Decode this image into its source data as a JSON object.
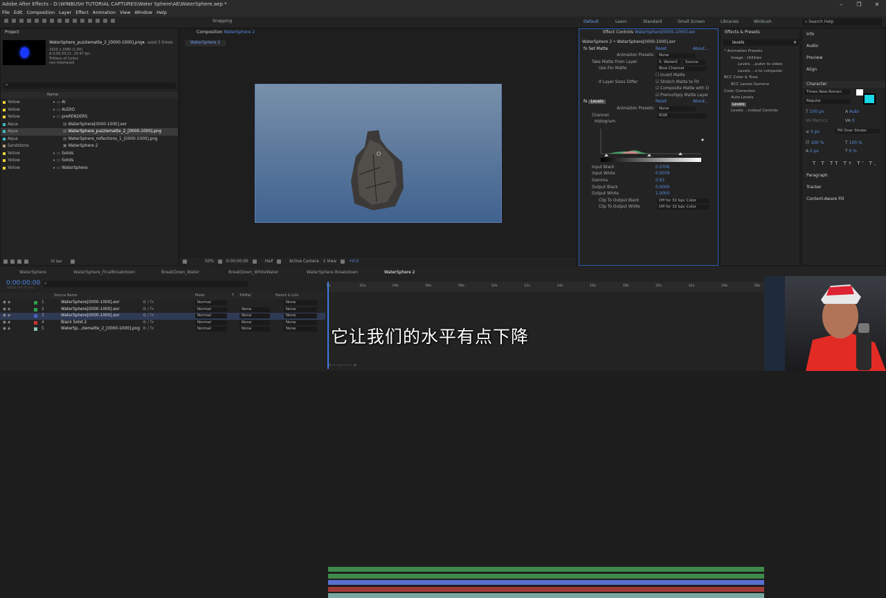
{
  "window": {
    "title": "Adobe After Effects - D:\\WINBUSH TUTORIAL CAPTURES\\Water Sphere\\AE\\WaterSphere.aep *"
  },
  "menu": [
    "File",
    "Edit",
    "Composition",
    "Layer",
    "Effect",
    "Animation",
    "View",
    "Window",
    "Help"
  ],
  "toolbar": {
    "snapping": "Snapping",
    "workspaces": [
      "Default",
      "Learn",
      "Standard",
      "Small Screen",
      "Libraries",
      "Winbush"
    ],
    "search_help": "Search Help"
  },
  "project": {
    "title": "Project",
    "item_name": "WaterSphere_puzzlematte_2_[0000-1000].png▾",
    "used": ", used 5 times",
    "info": [
      "1920 x 1080 (1.00)",
      "Δ 0;00;33;11, 29.97 fps",
      "Trillions of Colors",
      "non-interlaced"
    ],
    "col_name": "Name",
    "items": [
      {
        "label": "Yellow",
        "color": "#e8d23a",
        "name": "AI",
        "type": "folder",
        "indent": 0
      },
      {
        "label": "Yellow",
        "color": "#e8d23a",
        "name": "AUDIO",
        "type": "folder",
        "indent": 0
      },
      {
        "label": "Yellow",
        "color": "#e8d23a",
        "name": "preRENDERS",
        "type": "folder",
        "indent": 0
      },
      {
        "label": "Aqua",
        "color": "#3bbfc4",
        "name": "WaterSphere[0000-1000].exr",
        "type": "file",
        "indent": 1
      },
      {
        "label": "Aqua",
        "color": "#3bbfc4",
        "name": "WaterSphere_puzzlematte_2_[0000-1000].png",
        "type": "file",
        "indent": 1,
        "selected": true
      },
      {
        "label": "Aqua",
        "color": "#3bbfc4",
        "name": "WaterSphere_reflections_1_[0000-1000].png",
        "type": "file",
        "indent": 1
      },
      {
        "label": "Sandstone",
        "color": "#b5a37d",
        "name": "WaterSphere 2",
        "type": "comp",
        "indent": 1
      },
      {
        "label": "Yellow",
        "color": "#e8d23a",
        "name": "Solids",
        "type": "folder",
        "indent": 0
      },
      {
        "label": "Yellow",
        "color": "#e8d23a",
        "name": "Solids",
        "type": "folder",
        "indent": 0
      },
      {
        "label": "Yellow",
        "color": "#e8d23a",
        "name": "WaterSphere",
        "type": "folder",
        "indent": 0
      }
    ],
    "bpc": "32 bpc"
  },
  "composition": {
    "tab": "Composition",
    "comp_name": "WaterSphere 2",
    "subtab": "WaterSphere 2",
    "zoom": "50%",
    "timecode": "0:00:00:00",
    "resolution": "Half",
    "camera": "Active Camera",
    "view": "1 View",
    "exposure": "+0.0"
  },
  "effect_controls": {
    "tab": "Effect Controls",
    "layer": "WaterSphere[0000-1000].exr",
    "path": "WaterSphere 2 • WaterSphere[0000-1000].exr",
    "set_matte": {
      "name": "Set Matte",
      "reset": "Reset",
      "about": "About...",
      "presets_label": "Animation Presets:",
      "presets_value": "None",
      "take_matte_label": "Take Matte From Layer",
      "take_matte_value": "5. WaterS",
      "source": "Source",
      "use_for_matte_label": "Use For Matte",
      "use_for_matte_value": "Blue Channel",
      "invert": "Invert Matte",
      "sizes_differ": "If Layer Sizes Differ",
      "stretch": "Stretch Matte to Fit",
      "composite": "Composite Matte with O",
      "premultiply": "Premultiply Matte Layer"
    },
    "levels": {
      "name": "Levels",
      "reset": "Reset",
      "about": "About...",
      "presets_label": "Animation Presets:",
      "presets_value": "None",
      "channel_label": "Channel:",
      "channel_value": "RGB",
      "histogram": "Histogram",
      "params": [
        {
          "label": "Input Black",
          "value": "0.0706"
        },
        {
          "label": "Input White",
          "value": "0.0078"
        },
        {
          "label": "Gamma",
          "value": "0.83"
        },
        {
          "label": "Output Black",
          "value": "0.0000"
        },
        {
          "label": "Output White",
          "value": "1.0000"
        }
      ],
      "clip_black_label": "Clip To Output Black",
      "clip_black_value": "Off for 32 bpc Color",
      "clip_white_label": "Clip To Output White",
      "clip_white_value": "Off for 32 bpc Color"
    }
  },
  "effects_presets": {
    "title": "Effects & Presets",
    "search": "levels",
    "tree": [
      {
        "text": "* Animation Presets",
        "indent": 0
      },
      {
        "text": "Image - Utilities",
        "indent": 1
      },
      {
        "text": "Levels ...puter to video",
        "indent": 2
      },
      {
        "text": "Levels ...o to computer",
        "indent": 2
      },
      {
        "text": "BCC Color & Tone",
        "indent": 0
      },
      {
        "text": "BCC Levels Gamma",
        "indent": 1
      },
      {
        "text": "Color Correction",
        "indent": 0
      },
      {
        "text": "Auto Levels",
        "indent": 1
      },
      {
        "text": "Levels",
        "indent": 1,
        "selected": true
      },
      {
        "text": "Levels ...lvidual Controls",
        "indent": 1
      }
    ]
  },
  "side_panels": {
    "items": [
      "Info",
      "Audio",
      "Preview",
      "Align"
    ],
    "character": "Character",
    "font": "Times New Roman",
    "style": "Regular",
    "size": "100 px",
    "leading": "Auto",
    "kern": "Metrics",
    "track": "0",
    "stroke_w": "5 px",
    "stroke_type": "Fill Over Stroke",
    "v_scale": "100 %",
    "h_scale": "100 %",
    "baseline": "0 px",
    "tsume": "0 %",
    "lower": [
      "Paragraph",
      "Tracker",
      "Content-Aware Fill"
    ]
  },
  "timeline": {
    "tabs": [
      "WaterSphere",
      "WaterSphere_FinalBreakdown",
      "BreakDown_Water",
      "BreakDown_WhiteWater",
      "WaterSphere Breakdown",
      "WaterSphere 2"
    ],
    "timecode": "0:00:00:00",
    "fps": "00000 (29.97 fps)",
    "cols": {
      "source": "Source Name",
      "mode": "Mode",
      "t": "T",
      "trkmat": "TrkMat",
      "parent": "Parent & Link"
    },
    "ruler": [
      "0s",
      "02s",
      "04s",
      "06s",
      "08s",
      "10s",
      "12s",
      "14s",
      "16s",
      "18s",
      "20s",
      "22s",
      "24s",
      "26s"
    ],
    "layers": [
      {
        "num": "1",
        "name": "WaterSphere[0000-1000].exr",
        "color": "#2f9e4b",
        "mode": "Normal",
        "trkmat": "",
        "parent": "None",
        "bar": "#3f8a4a"
      },
      {
        "num": "2",
        "name": "WaterSphere[0000-1000].exr",
        "color": "#2f9e4b",
        "mode": "Normal",
        "trkmat": "None",
        "parent": "None",
        "bar": "#3f8a4a"
      },
      {
        "num": "3",
        "name": "WaterSphere[0000-1000].exr",
        "color": "#4b62c8",
        "mode": "Normal",
        "trkmat": "None",
        "parent": "None",
        "bar": "#5a6fd0",
        "selected": true
      },
      {
        "num": "4",
        "name": "Black Solid 2",
        "color": "#c33",
        "mode": "Normal",
        "trkmat": "None",
        "parent": "None",
        "bar": "#a33a3a"
      },
      {
        "num": "5",
        "name": "WaterSp...zlematte_2_[0000-1000].png",
        "color": "#8fc0b6",
        "mode": "Normal",
        "trkmat": "None",
        "parent": "None",
        "bar": "#7aa6a1"
      }
    ]
  },
  "subtitle": "它让我们的水平有点下降",
  "colors": {
    "accent": "#6f9cf0",
    "selection": "#4a7cd8"
  }
}
